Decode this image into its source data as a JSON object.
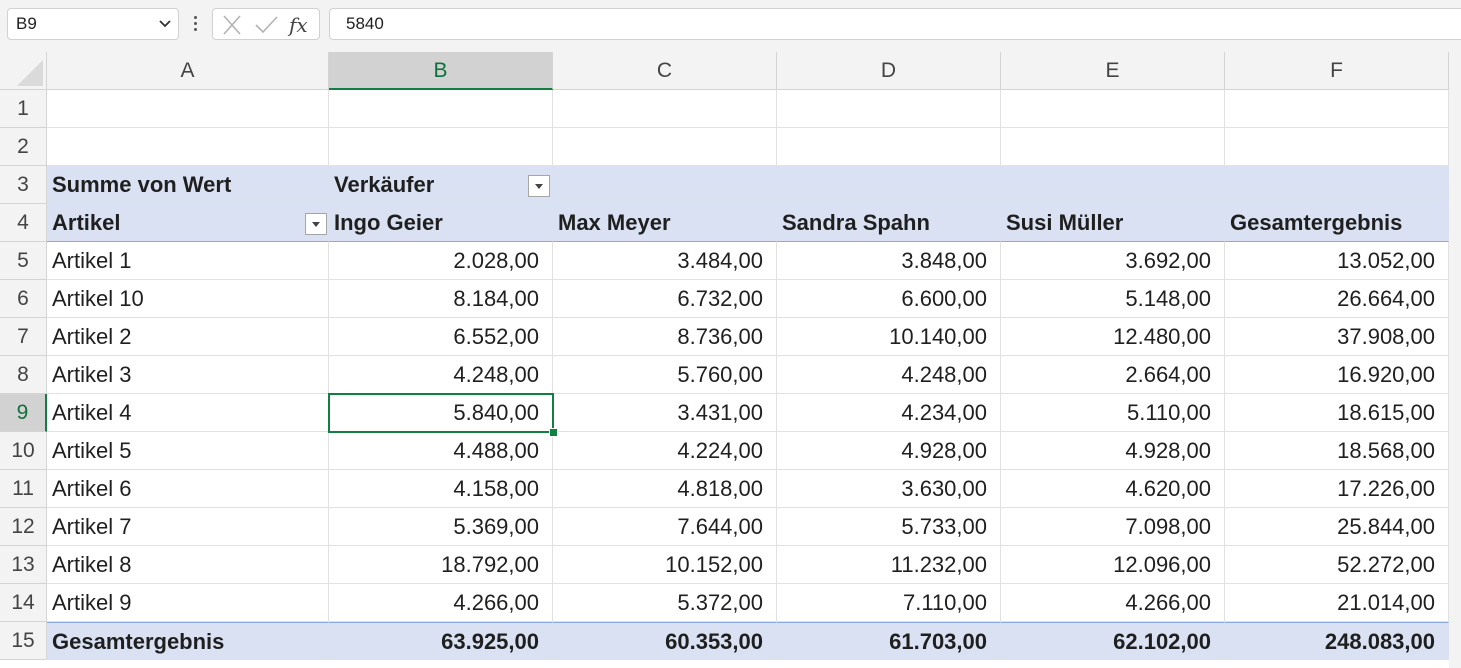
{
  "name_box": "B9",
  "formula_value": "5840",
  "columns": [
    "A",
    "B",
    "C",
    "D",
    "E",
    "F"
  ],
  "selected_column": "B",
  "rows": [
    "1",
    "2",
    "3",
    "4",
    "5",
    "6",
    "7",
    "8",
    "9",
    "10",
    "11",
    "12",
    "13",
    "14",
    "15"
  ],
  "selected_row": "9",
  "pivot": {
    "sum_label": "Summe von Wert",
    "column_field": "Verkäufer",
    "row_field": "Artikel",
    "sellers": [
      "Ingo Geier",
      "Max Meyer",
      "Sandra Spahn",
      "Susi Müller",
      "Gesamtergebnis"
    ],
    "data": [
      [
        "Artikel 1",
        "2.028,00",
        "3.484,00",
        "3.848,00",
        "3.692,00",
        "13.052,00"
      ],
      [
        "Artikel 10",
        "8.184,00",
        "6.732,00",
        "6.600,00",
        "5.148,00",
        "26.664,00"
      ],
      [
        "Artikel 2",
        "6.552,00",
        "8.736,00",
        "10.140,00",
        "12.480,00",
        "37.908,00"
      ],
      [
        "Artikel 3",
        "4.248,00",
        "5.760,00",
        "4.248,00",
        "2.664,00",
        "16.920,00"
      ],
      [
        "Artikel 4",
        "5.840,00",
        "3.431,00",
        "4.234,00",
        "5.110,00",
        "18.615,00"
      ],
      [
        "Artikel 5",
        "4.488,00",
        "4.224,00",
        "4.928,00",
        "4.928,00",
        "18.568,00"
      ],
      [
        "Artikel 6",
        "4.158,00",
        "4.818,00",
        "3.630,00",
        "4.620,00",
        "17.226,00"
      ],
      [
        "Artikel 7",
        "5.369,00",
        "7.644,00",
        "5.733,00",
        "7.098,00",
        "25.844,00"
      ],
      [
        "Artikel 8",
        "18.792,00",
        "10.152,00",
        "11.232,00",
        "12.096,00",
        "52.272,00"
      ],
      [
        "Artikel 9",
        "4.266,00",
        "5.372,00",
        "7.110,00",
        "4.266,00",
        "21.014,00"
      ]
    ],
    "total": [
      "Gesamtergebnis",
      "63.925,00",
      "60.353,00",
      "61.703,00",
      "62.102,00",
      "248.083,00"
    ]
  },
  "icons": {
    "cancel": "x-icon",
    "enter": "checkmark-icon",
    "function": "fx-icon",
    "filter": "filter-dropdown-icon"
  },
  "colors": {
    "pivot_header_fill": "#d9e1f2",
    "pivot_border": "#8ea9db",
    "selection": "#137e43"
  }
}
